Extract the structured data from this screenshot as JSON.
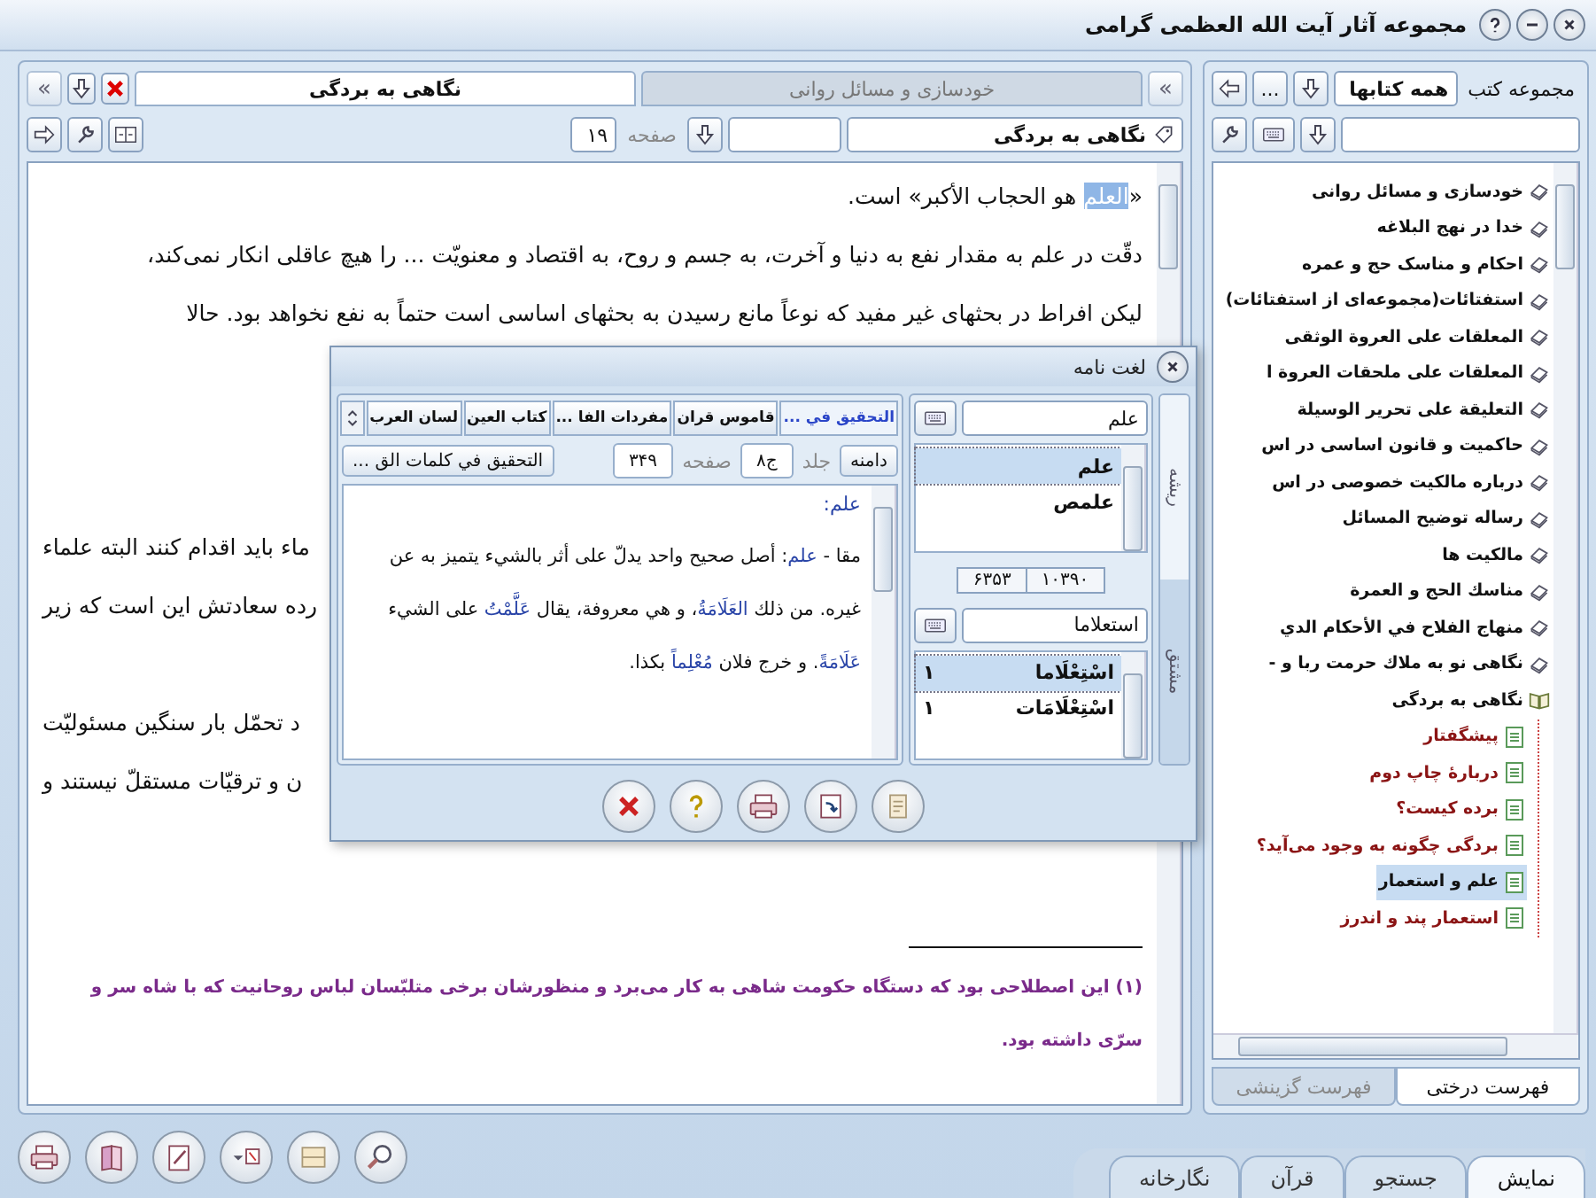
{
  "window": {
    "title": "مجموعه آثار آیت الله العظمی گرامی"
  },
  "library": {
    "label": "مجموعه کتب",
    "collection": "همه کتابها",
    "more": "..."
  },
  "tree": {
    "items": [
      {
        "title": "خودسازی و مسائل روانی",
        "expanded": false,
        "selected": false
      },
      {
        "title": "خدا در نهج البلاغه",
        "expanded": false,
        "selected": false
      },
      {
        "title": "احکام و مناسک حج و عمره",
        "expanded": false,
        "selected": false
      },
      {
        "title": "استفتائات(مجموعه‌ای از استفتائات)",
        "expanded": false,
        "selected": false
      },
      {
        "title": "المعلقات على العروة الوثقى",
        "expanded": false,
        "selected": false
      },
      {
        "title": "المعلقات على ملحقات العروة ا",
        "expanded": false,
        "selected": false
      },
      {
        "title": "التعليقة على تحرير الوسيلة",
        "expanded": false,
        "selected": false
      },
      {
        "title": "حاکمیت و قانون اساسی در اس",
        "expanded": false,
        "selected": false
      },
      {
        "title": "درباره مالکیت خصوصی در اس",
        "expanded": false,
        "selected": false
      },
      {
        "title": "رساله توضیح المسائل",
        "expanded": false,
        "selected": false
      },
      {
        "title": "مالکیت ها",
        "expanded": false,
        "selected": false
      },
      {
        "title": "مناسك الحج و العمرة",
        "expanded": false,
        "selected": false
      },
      {
        "title": "منهاج الفلاح في الأحكام الدي",
        "expanded": false,
        "selected": false
      },
      {
        "title": "نگاهی نو به ملاك حرمت ربا و -",
        "expanded": false,
        "selected": false
      },
      {
        "title": "نگاهی به بردگی",
        "expanded": true,
        "selected": false,
        "children": [
          {
            "title": "پیشگفتار",
            "selected": false
          },
          {
            "title": "دربارهٔ چاپ دوم",
            "selected": false
          },
          {
            "title": "برده کیست؟",
            "selected": false
          },
          {
            "title": "بردگی چگونه به وجود می‌آید؟",
            "selected": false
          },
          {
            "title": "علم و استعمار",
            "selected": true
          },
          {
            "title": "استعمار پند و اندرز",
            "selected": false
          }
        ]
      }
    ]
  },
  "tree_tabs": [
    {
      "label": "فهرست درختی",
      "selected": true
    },
    {
      "label": "فهرست گزینشی",
      "selected": false
    }
  ],
  "reader": {
    "tabs": [
      {
        "label": "خودسازی و مسائل روانی",
        "selected": false
      },
      {
        "label": "نگاهی به بردگی",
        "selected": true
      }
    ],
    "scroll_start": "«",
    "scroll_end": "«",
    "book_field": "نگاهی به بردگی",
    "page_label": "صفحه",
    "page": "۱۹",
    "lines": [
      {
        "kind": "full",
        "parts": [
          {
            "text": "«",
            "selected": false
          },
          {
            "text": "العلم",
            "selected": true
          },
          {
            "text": " هو الحجاب الأكبر» است.",
            "selected": false
          }
        ]
      },
      {
        "kind": "full",
        "text": "دقّت در علم به مقدار نفع به دنیا و آخرت، به جسم و روح، به اقتصاد و معنویّت ... را هیچ عاقلی انکار نمی‌کند،"
      },
      {
        "kind": "full",
        "text": "لیکن افراط در بحثهای غیر مفید که نوعاً مانع رسیدن به بحثهای اساسی است حتماً به نفع نخواهد بود. حالا"
      },
      {
        "kind": "blank"
      },
      {
        "kind": "blank"
      },
      {
        "kind": "blank"
      },
      {
        "kind": "left",
        "text": "ماء باید اقدام کنند البته علماء"
      },
      {
        "kind": "left",
        "text": "رده سعادتش این است که زیر"
      },
      {
        "kind": "blank"
      },
      {
        "kind": "left",
        "text": "د تحمّل بار سنگین مسئولیّت"
      },
      {
        "kind": "left",
        "text": "ن و ترقیّات مستقلّ نیستند و"
      }
    ],
    "footnote": "(۱) این اصطلاحی بود که دستگاه حکومت شاهی به کار می‌برد و منظورشان برخی متلبّسان لباس روحانیت که با شاه سر و سرّی داشته بود."
  },
  "bottom_tabs": [
    {
      "label": "نمایش",
      "selected": true
    },
    {
      "label": "جستجو",
      "selected": false
    },
    {
      "label": "قرآن",
      "selected": false
    },
    {
      "label": "نگارخانه",
      "selected": false
    }
  ],
  "dictionary": {
    "title": "لغت نامه",
    "side_tabs": [
      {
        "label": "ریشه",
        "selected": true
      },
      {
        "label": "مشتق",
        "selected": false
      }
    ],
    "root_search": "علم",
    "roots": [
      {
        "text": "علم",
        "selected": true
      },
      {
        "text": "علمص",
        "selected": false
      }
    ],
    "counter": {
      "current": "۱۰۳۹۰",
      "total": "۶۳۵۳"
    },
    "derived_search": "استعلاما",
    "derived": [
      {
        "text": "اسْتِعْلَاما",
        "count": "۱",
        "selected": true
      },
      {
        "text": "اسْتِعْلَامَات",
        "count": "۱",
        "selected": false
      }
    ],
    "sources": [
      {
        "label": "التحقيق في ...",
        "selected": true
      },
      {
        "label": "قاموس قران",
        "selected": false
      },
      {
        "label": "مفردات الفا ...",
        "selected": false
      },
      {
        "label": "كتاب العين",
        "selected": false
      },
      {
        "label": "لسان العرب",
        "selected": false
      }
    ],
    "scope_button": "دامنه",
    "volume_label": "جلد",
    "volume": "ج۸",
    "page_label": "صفحه",
    "page": "۳۴۹",
    "book_button": "التحقيق في كلمات الق ...",
    "entry_heading": "علم:",
    "entry": [
      {
        "text": "مقا - ",
        "term": false
      },
      {
        "text": "علم",
        "term": true
      },
      {
        "text": ": أصل صحيح واحد يدلّ على أثر بالشيء يتميز به عن غيره. من ذلك ",
        "term": false
      },
      {
        "text": "العَلَامَةُ",
        "term": true
      },
      {
        "text": "، و هي معروفة، يقال ",
        "term": false
      },
      {
        "text": "عَلَّمْتُ",
        "term": true
      },
      {
        "text": " على الشيء ",
        "term": false
      },
      {
        "text": "عَلَامَةً",
        "term": true
      },
      {
        "text": ". و خرج فلان ",
        "term": false
      },
      {
        "text": "مُعْلِماً",
        "term": true
      },
      {
        "text": " بكذا.",
        "term": false
      }
    ]
  }
}
